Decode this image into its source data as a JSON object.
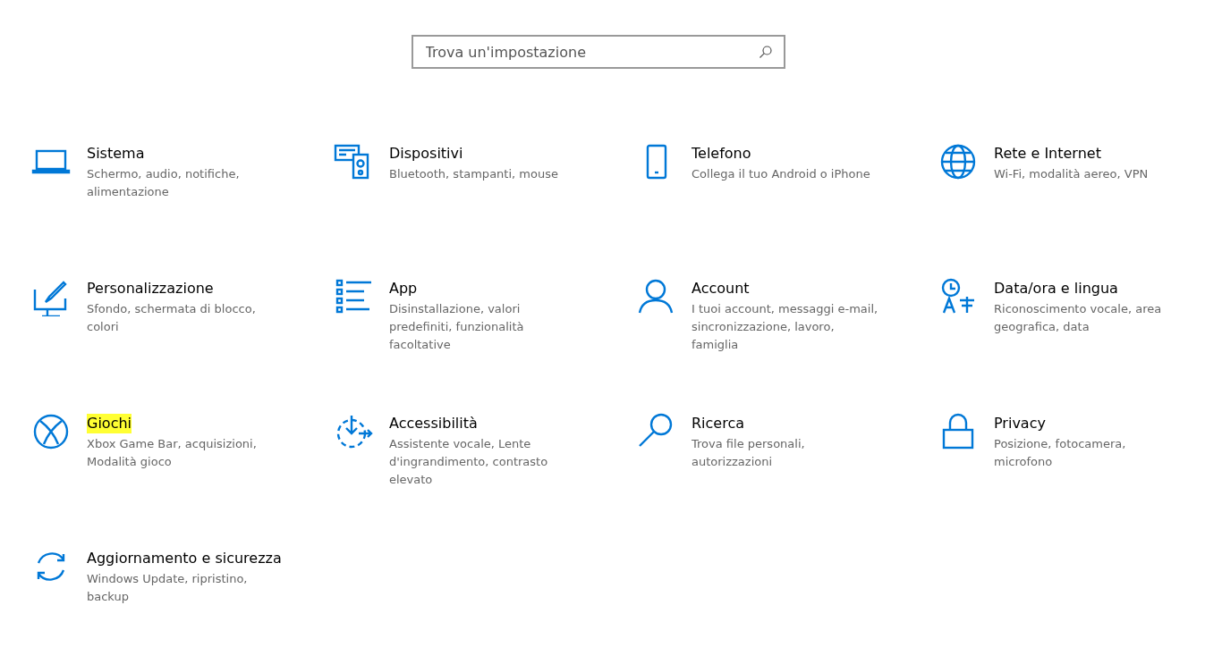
{
  "search": {
    "placeholder": "Trova un'impostazione"
  },
  "categories": [
    {
      "title": "Sistema",
      "description": [
        "Schermo, audio, notifiche,",
        "alimentazione"
      ],
      "highlighted": false
    },
    {
      "title": "Dispositivi",
      "description": [
        "Bluetooth, stampanti, mouse"
      ],
      "highlighted": false
    },
    {
      "title": "Telefono",
      "description": [
        "Collega il tuo Android o iPhone"
      ],
      "highlighted": false
    },
    {
      "title": "Rete e Internet",
      "description": [
        "Wi-Fi, modalità aereo, VPN"
      ],
      "highlighted": false
    },
    {
      "title": "Personalizzazione",
      "description": [
        "Sfondo, schermata di blocco,",
        "colori"
      ],
      "highlighted": false
    },
    {
      "title": "App",
      "description": [
        "Disinstallazione, valori",
        "predefiniti, funzionalità",
        "facoltative"
      ],
      "highlighted": false
    },
    {
      "title": "Account",
      "description": [
        "I tuoi account, messaggi e-mail,",
        "sincronizzazione, lavoro,",
        "famiglia"
      ],
      "highlighted": false
    },
    {
      "title": "Data/ora e lingua",
      "description": [
        "Riconoscimento vocale, area",
        "geografica, data"
      ],
      "highlighted": false
    },
    {
      "title": "Giochi",
      "description": [
        "Xbox Game Bar, acquisizioni,",
        "Modalità gioco"
      ],
      "highlighted": true
    },
    {
      "title": "Accessibilità",
      "description": [
        "Assistente vocale, Lente",
        "d'ingrandimento, contrasto",
        "elevato"
      ],
      "highlighted": false
    },
    {
      "title": "Ricerca",
      "description": [
        "Trova file personali,",
        "autorizzazioni"
      ],
      "highlighted": false
    },
    {
      "title": "Privacy",
      "description": [
        "Posizione, fotocamera,",
        "microfono"
      ],
      "highlighted": false
    },
    {
      "title": "Aggiornamento e sicurezza",
      "description": [
        "Windows Update, ripristino,",
        "backup"
      ],
      "highlighted": false
    }
  ]
}
